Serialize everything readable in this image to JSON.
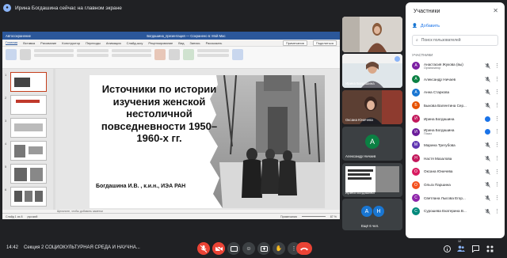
{
  "banner": {
    "text": "Ирина Богдашина сейчас на главном экране"
  },
  "ppt": {
    "autosave": "Автосохранение",
    "filename": "Богдашина_презентация",
    "saved": "Сохранено в: Мой Mac",
    "tabs": [
      "Главная",
      "Вставка",
      "Рисование",
      "Конструктор",
      "Переходы",
      "Анимация",
      "Слайд-шоу",
      "Рецензирование",
      "Вид",
      "Запись",
      "Рассказать"
    ],
    "comments_btn": "Примечания",
    "share_btn": "Поделиться",
    "notes_placeholder": "Щелкните, чтобы добавить заметки",
    "status_slide": "Слайд 1 из 8",
    "status_lang": "русский",
    "status_notes": "Примечания",
    "status_zoom": "87 %"
  },
  "slide": {
    "title": "Источники по истории изучения женской нестоличной повседневности 1950–1960-х гг.",
    "author": "Богдашина И.В. , к.и.н., ИЭА РАН"
  },
  "tiles": [
    {
      "name": "",
      "kind": "video-woman"
    },
    {
      "name": "Ирина Богдашина",
      "kind": "video"
    },
    {
      "name": "Оксана Юничева",
      "kind": "video"
    },
    {
      "name": "Александр Ничаев",
      "initial": "A",
      "color": "#0b8043"
    },
    {
      "name": "Ирина Богдашина",
      "kind": "slide"
    },
    {
      "name": "Ещё 6 чел.",
      "initials": [
        "А",
        "Н"
      ]
    }
  ],
  "panel": {
    "title": "Участники",
    "add": "Добавить",
    "search_placeholder": "Поиск пользователей",
    "section": "УЧАСТНИКИ",
    "people": [
      {
        "name": "Анастасия Жукова (вы)",
        "sub": "Организатор",
        "initial": "А",
        "color": "#7b1fa2",
        "mic": "off"
      },
      {
        "name": "Александр Ничаев",
        "sub": "",
        "initial": "А",
        "color": "#0b8043",
        "mic": "off"
      },
      {
        "name": "Анна Старкова",
        "sub": "",
        "initial": "А",
        "color": "#1976d2",
        "mic": "off"
      },
      {
        "name": "Быкова Валентина Сер...",
        "sub": "",
        "initial": "Б",
        "color": "#e65100",
        "mic": "off"
      },
      {
        "name": "Ирина Богдашина",
        "sub": "",
        "initial": "И",
        "color": "#c2185b",
        "mic": "on"
      },
      {
        "name": "Ирина Богдашина",
        "sub": "Показ",
        "initial": "И",
        "color": "#6a1b9a",
        "mic": "on"
      },
      {
        "name": "Марина Трегубова",
        "sub": "",
        "initial": "М",
        "color": "#5e35b1",
        "mic": "off"
      },
      {
        "name": "Настя Мазалова",
        "sub": "",
        "initial": "Н",
        "color": "#c2185b",
        "mic": "off"
      },
      {
        "name": "Оксана Юничева",
        "sub": "",
        "initial": "О",
        "color": "#d81b60",
        "mic": "off"
      },
      {
        "name": "Ольга Паршина",
        "sub": "",
        "initial": "О",
        "color": "#f4511e",
        "mic": "off"
      },
      {
        "name": "Светлана Лысова Егор...",
        "sub": "",
        "initial": "С",
        "color": "#8e24aa",
        "mic": "off"
      },
      {
        "name": "Сурошева Екатерина В...",
        "sub": "",
        "initial": "С",
        "color": "#00897b",
        "mic": "off"
      }
    ]
  },
  "bottom": {
    "time": "14:42",
    "meeting": "Секция 2 СОЦИОКУЛЬТУРНАЯ СРЕДА И НАУЧНА...",
    "count": "12"
  }
}
